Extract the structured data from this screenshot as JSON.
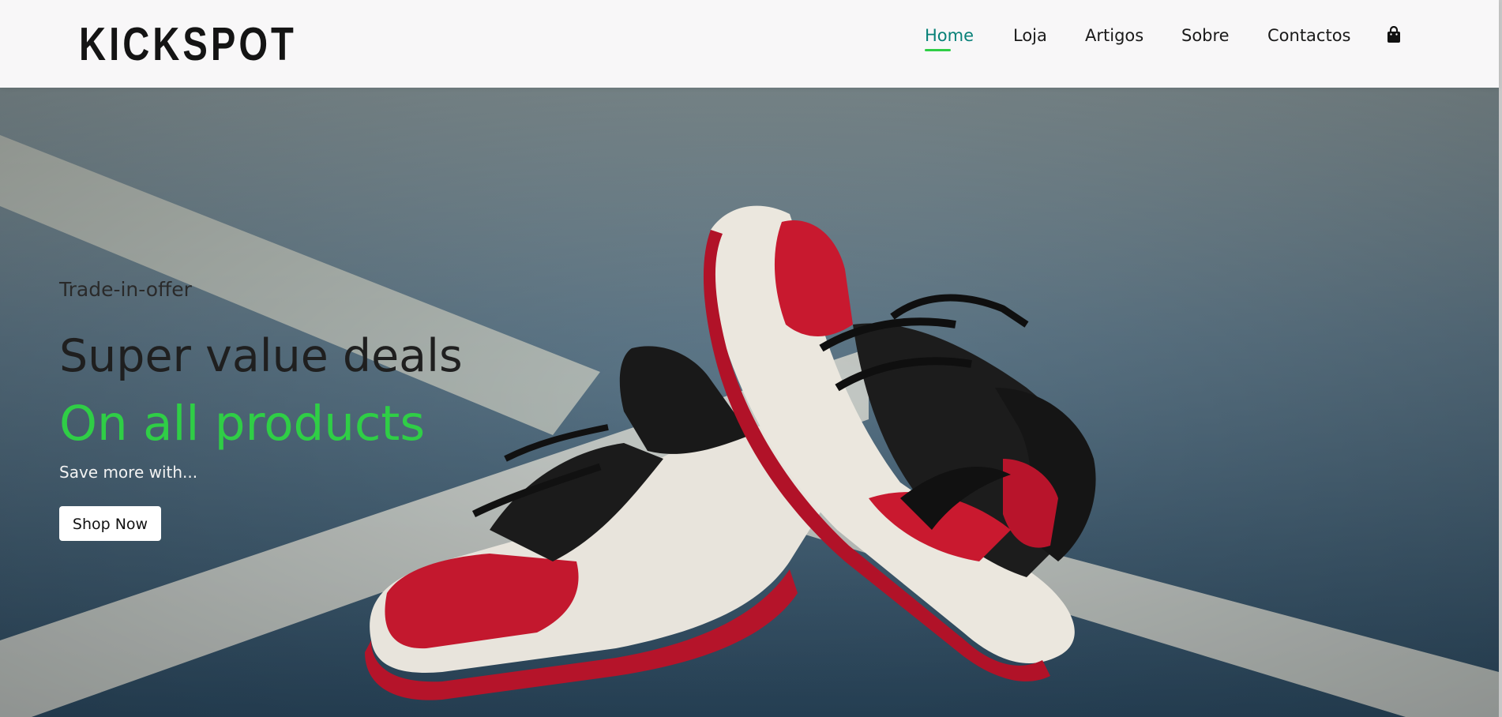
{
  "header": {
    "logo_text": "KICKSPOT",
    "nav": [
      {
        "label": "Home",
        "active": true
      },
      {
        "label": "Loja",
        "active": false
      },
      {
        "label": "Artigos",
        "active": false
      },
      {
        "label": "Sobre",
        "active": false
      },
      {
        "label": "Contactos",
        "active": false
      }
    ],
    "cart_icon": "shopping-bag-icon",
    "active_color": "#088178",
    "underline_color": "#2fce46"
  },
  "hero": {
    "offer_label": "Trade-in-offer",
    "title": "Super value deals",
    "highlight": "On all products",
    "subtitle": "Save more with...",
    "button_label": "Shop Now",
    "highlight_color": "#2fce46",
    "background_image": "red-black-white-sneakers-on-court"
  }
}
